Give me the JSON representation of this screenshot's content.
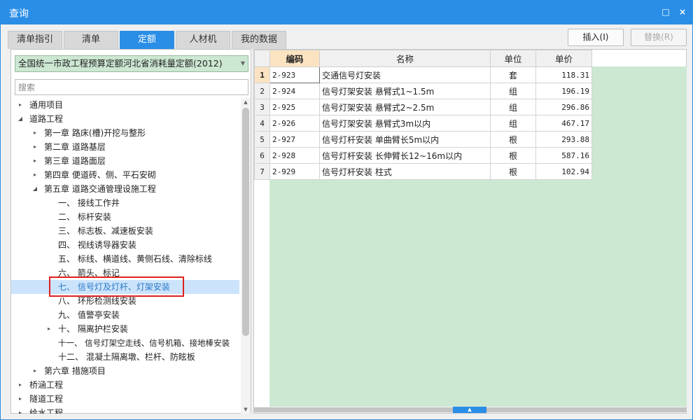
{
  "window": {
    "title": "查询",
    "restore_symbol": "□",
    "close_symbol": "×"
  },
  "tabs": [
    {
      "label": "清单指引",
      "active": false
    },
    {
      "label": "清单",
      "active": false
    },
    {
      "label": "定额",
      "active": true
    },
    {
      "label": "人材机",
      "active": false
    },
    {
      "label": "我的数据",
      "active": false
    }
  ],
  "toolbar": {
    "insert_label": "插入(I)",
    "replace_label": "替换(R)"
  },
  "left": {
    "library_selected": "全国统一市政工程预算定额河北省消耗量定额(2012)",
    "search_placeholder": "搜索",
    "tree": [
      {
        "label": "通用项目",
        "toggle": "▸",
        "level": 0
      },
      {
        "label": "道路工程",
        "toggle": "◢",
        "level": 0
      },
      {
        "label": "第一章 路床(槽)开挖与整形",
        "toggle": "▸",
        "level": 1
      },
      {
        "label": "第二章 道路基层",
        "toggle": "▸",
        "level": 1
      },
      {
        "label": "第三章 道路面层",
        "toggle": "▸",
        "level": 1
      },
      {
        "label": "第四章 便道砖、侧、平石安砌",
        "toggle": "▸",
        "level": 1
      },
      {
        "label": "第五章 道路交通管理设施工程",
        "toggle": "◢",
        "level": 1
      },
      {
        "label": "一、 接线工作井",
        "toggle": "",
        "level": 2
      },
      {
        "label": "二、 标杆安装",
        "toggle": "",
        "level": 2
      },
      {
        "label": "三、 标志板、减速板安装",
        "toggle": "",
        "level": 2
      },
      {
        "label": "四、 视线诱导器安装",
        "toggle": "",
        "level": 2
      },
      {
        "label": "五、 标线、横道线、黄侧石线、清除标线",
        "toggle": "",
        "level": 2
      },
      {
        "label": "六、 箭头、标记",
        "toggle": "",
        "level": 2
      },
      {
        "label": "七、 信号灯及灯杆、灯架安装",
        "toggle": "",
        "level": 2,
        "selected": true
      },
      {
        "label": "八、 环形检测线安装",
        "toggle": "",
        "level": 2
      },
      {
        "label": "九、 值警亭安装",
        "toggle": "",
        "level": 2
      },
      {
        "label": "十、 隔离护栏安装",
        "toggle": "▸",
        "level": 2
      },
      {
        "label": "十一、 信号灯架空走线、信号机箱、接地棒安装",
        "toggle": "",
        "level": 2
      },
      {
        "label": "十二、 混凝土隔离墩、栏杆、防眩板",
        "toggle": "",
        "level": 2
      },
      {
        "label": "第六章 措施项目",
        "toggle": "▸",
        "level": 1
      },
      {
        "label": "桥涵工程",
        "toggle": "▸",
        "level": 0
      },
      {
        "label": "隧道工程",
        "toggle": "▸",
        "level": 0
      },
      {
        "label": "给水工程",
        "toggle": "▸",
        "level": 0
      }
    ]
  },
  "grid": {
    "headers": {
      "code": "编码",
      "name": "名称",
      "unit": "单位",
      "price": "单价"
    },
    "rows": [
      {
        "no": "1",
        "code": "2-923",
        "name": "交通信号灯安装",
        "unit": "套",
        "price": "118.31"
      },
      {
        "no": "2",
        "code": "2-924",
        "name": "信号灯架安装 悬臂式1~1.5m",
        "unit": "组",
        "price": "196.19"
      },
      {
        "no": "3",
        "code": "2-925",
        "name": "信号灯架安装 悬臂式2~2.5m",
        "unit": "组",
        "price": "296.86"
      },
      {
        "no": "4",
        "code": "2-926",
        "name": "信号灯架安装 悬臂式3m以内",
        "unit": "组",
        "price": "467.17"
      },
      {
        "no": "5",
        "code": "2-927",
        "name": "信号灯杆安装 单曲臂长5m以内",
        "unit": "根",
        "price": "293.88"
      },
      {
        "no": "6",
        "code": "2-928",
        "name": "信号灯杆安装 长伸臂长12~16m以内",
        "unit": "根",
        "price": "587.16"
      },
      {
        "no": "7",
        "code": "2-929",
        "name": "信号灯杆安装 柱式",
        "unit": "根",
        "price": "102.94"
      }
    ]
  },
  "colors": {
    "accent": "#2a8ee6",
    "grid_bg": "#cde8d2",
    "highlight": "#fbe3c2",
    "annotation": "#e02020"
  }
}
